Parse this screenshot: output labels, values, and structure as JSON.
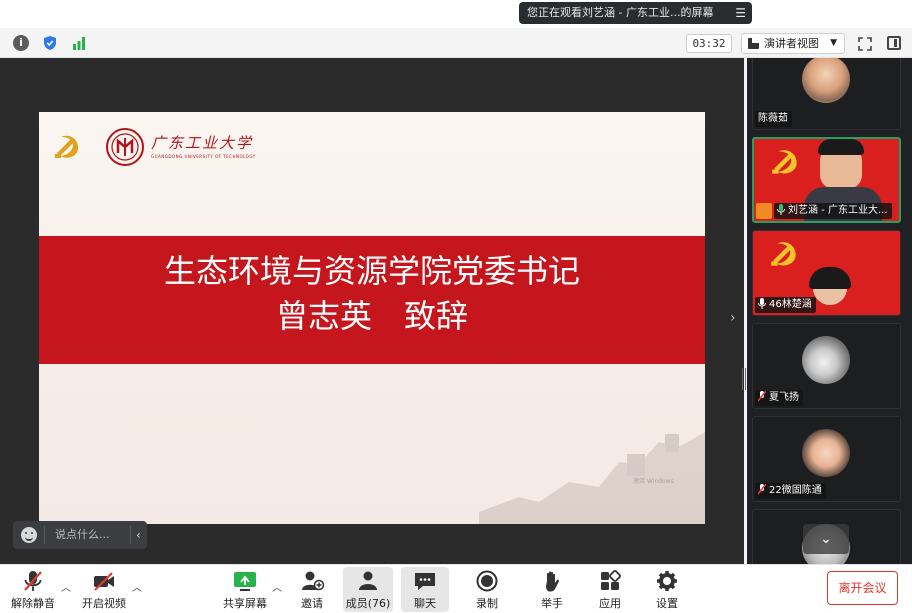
{
  "window": {
    "sharing_banner": "您正在观看刘艺涵 - 广东工业...的屏幕",
    "sharing_menu_icon": "menu-icon"
  },
  "toolbar": {
    "timer": "03:32",
    "view_label": "演讲者视图",
    "icons": [
      "info-icon",
      "shield-icon",
      "signal-icon",
      "fullscreen-icon",
      "side-panel-icon"
    ]
  },
  "slide": {
    "university_name": "广东工业大学",
    "university_subtitle": "GUANGDONG UNIVERSITY OF TECHNOLOGY",
    "title_line1": "生态环境与资源学院党委书记",
    "title_line2": "曾志英　致辞",
    "watermark": "激活 Windows"
  },
  "chat": {
    "placeholder": "说点什么..."
  },
  "participants": [
    {
      "name": "陈薇茹",
      "muted": false
    },
    {
      "name": "刘艺涵 - 广东工业大...",
      "speaking": true,
      "host": true
    },
    {
      "name": "46林楚涵",
      "muted": false
    },
    {
      "name": "夏飞扬",
      "muted": true
    },
    {
      "name": "22微固陈通",
      "muted": true
    },
    {
      "name": "",
      "muted": true
    }
  ],
  "controls": {
    "unmute": "解除静音",
    "start_video": "开启视频",
    "share_screen": "共享屏幕",
    "invite": "邀请",
    "members": "成员(76)",
    "chat": "聊天",
    "record": "录制",
    "raise_hand": "举手",
    "apps": "应用",
    "settings": "设置",
    "leave": "离开会议"
  },
  "colors": {
    "accent_red": "#c4161c",
    "active_border": "#26a05c",
    "leave_red": "#e1352b"
  }
}
